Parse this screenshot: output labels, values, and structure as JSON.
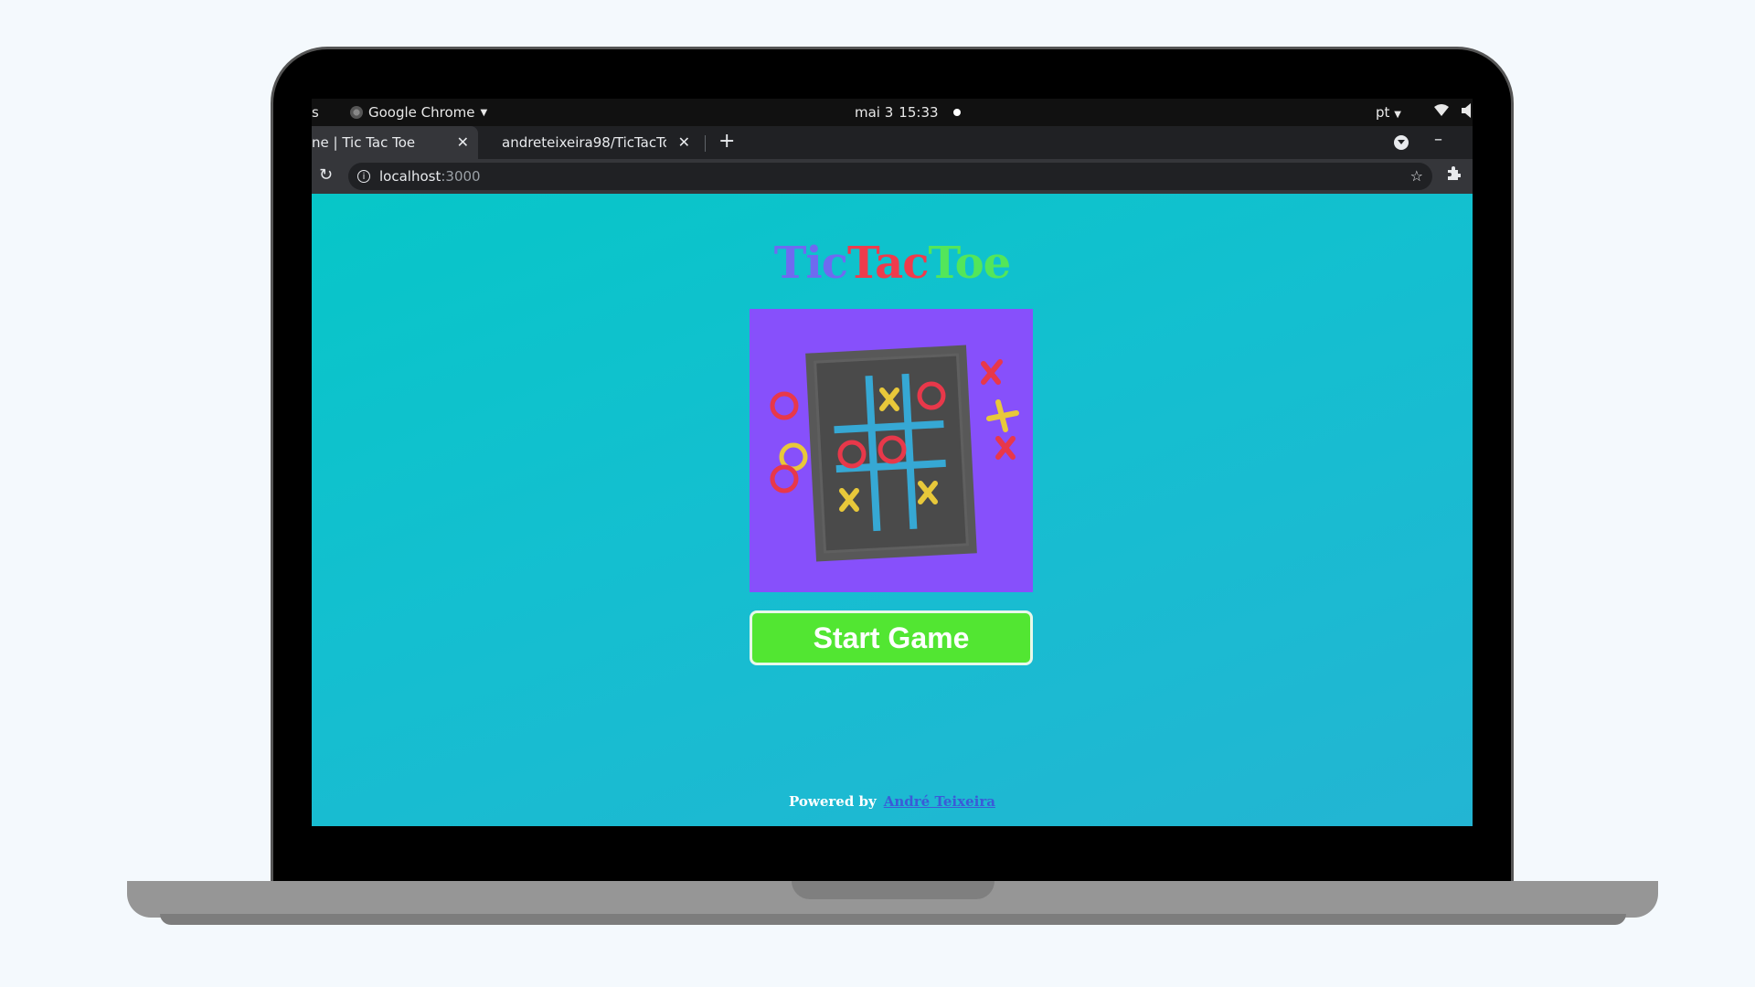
{
  "system_bar": {
    "activities_label": "s",
    "app_name": "Google Chrome",
    "date": "mai 3",
    "time": "15:33",
    "language": "pt"
  },
  "browser": {
    "tabs": [
      {
        "label": "ne | Tic Tac Toe",
        "active": true
      },
      {
        "label": "andreteixeira98/TicTacTo",
        "active": false
      }
    ],
    "new_tab_icon": "plus-icon",
    "address": {
      "host": "localhost",
      "port": ":3000"
    }
  },
  "page": {
    "title": {
      "part1": "Tic",
      "part2": "Tac",
      "part3": "Toe"
    },
    "start_button_label": "Start Game",
    "footer": {
      "powered_by": "Powered by",
      "author": "André Teixeira"
    },
    "colors": {
      "background_start": "#07c6c8",
      "background_end": "#23b5d3",
      "title_tic": "#6f6af0",
      "title_tac": "#ef3b4c",
      "title_toe": "#53e65a",
      "illustration_bg": "#8750fb",
      "button": "#52e632",
      "author_link": "#3a5bd8"
    }
  }
}
